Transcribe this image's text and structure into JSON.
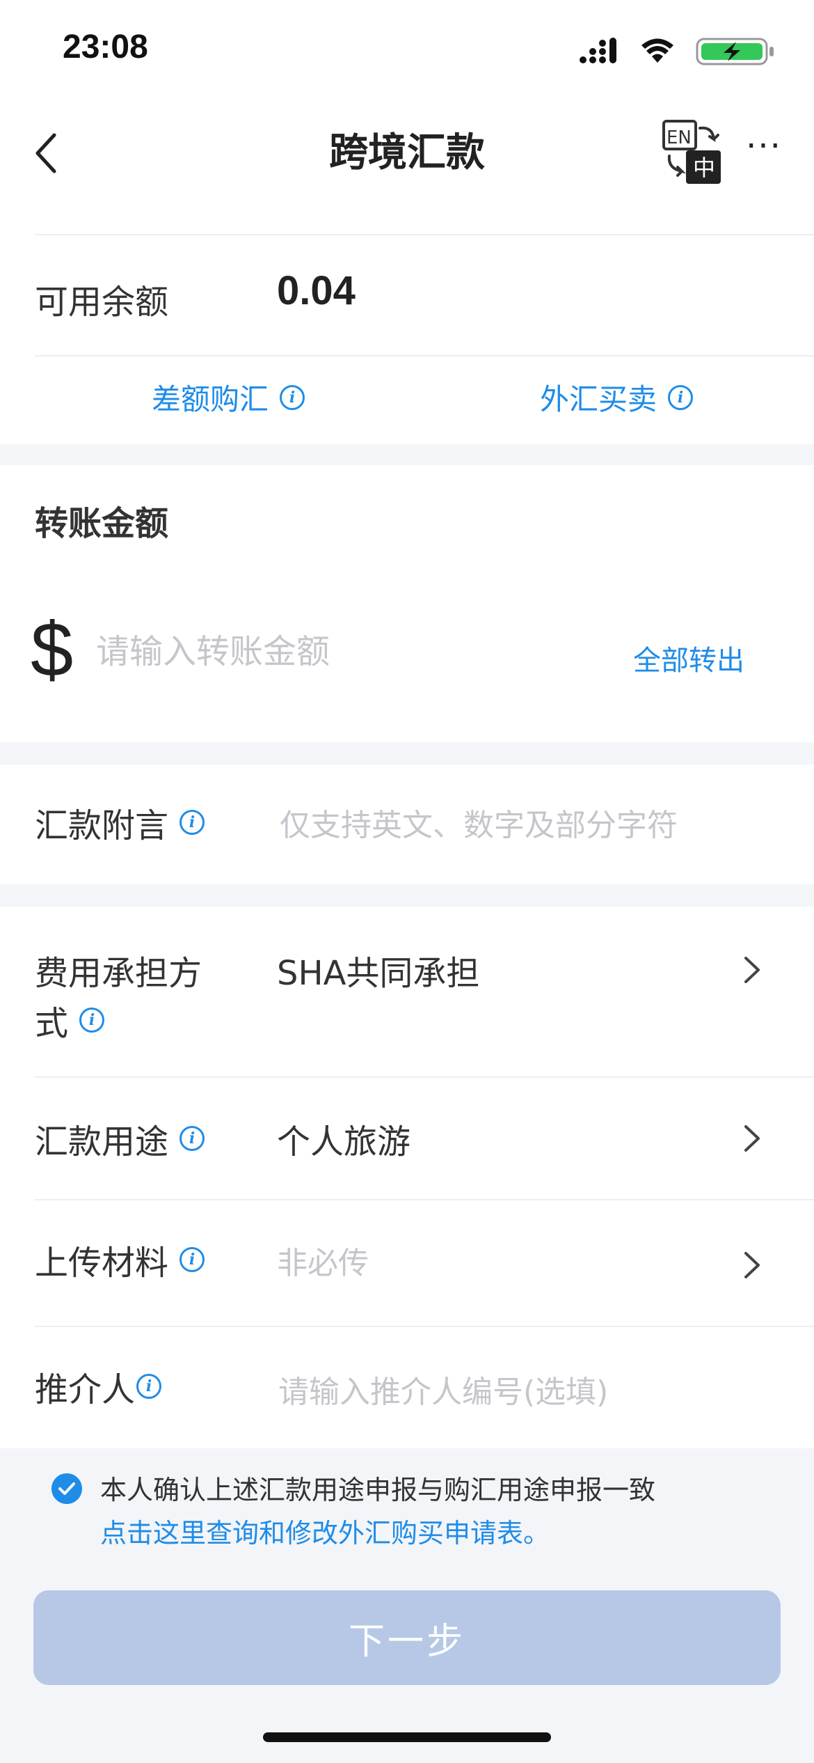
{
  "status_bar": {
    "time": "23:08",
    "icons": [
      "signal-icon",
      "wifi-icon",
      "battery-charging-icon"
    ]
  },
  "nav": {
    "title": "跨境汇款",
    "lang_icon_text_en": "EN",
    "lang_icon_text_zh": "中",
    "more": "···"
  },
  "balance": {
    "label": "可用余额",
    "value": "0.04",
    "links": [
      {
        "label": "差额购汇"
      },
      {
        "label": "外汇买卖"
      }
    ]
  },
  "amount": {
    "label": "转账金额",
    "currency": "$",
    "placeholder": "请输入转账金额",
    "all_out": "全部转出"
  },
  "remark": {
    "label": "汇款附言",
    "placeholder": "仅支持英文、数字及部分字符"
  },
  "form": {
    "fee": {
      "label_line1": "费用承担方",
      "label_line2": "式",
      "value": "SHA共同承担"
    },
    "purpose": {
      "label": "汇款用途",
      "value": "个人旅游"
    },
    "upload": {
      "label": "上传材料",
      "placeholder": "非必传"
    },
    "referrer": {
      "label": "推介人",
      "placeholder": "请输入推介人编号(选填)"
    }
  },
  "agreement": {
    "checked": true,
    "text": "本人确认上述汇款用途申报与购汇用途申报一致",
    "link": "点击这里查询和修改外汇购买申请表。"
  },
  "next_button": "下一步",
  "colors": {
    "accent": "#1f8ce8",
    "button_disabled": "#b6c8e6",
    "placeholder": "#c4c6cb",
    "battery_green": "#34c759"
  }
}
